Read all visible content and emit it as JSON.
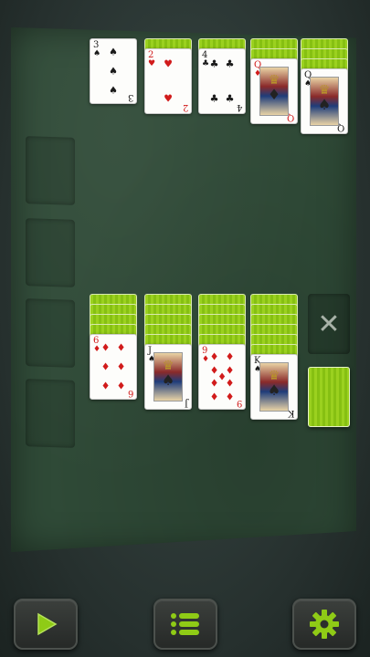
{
  "game": "Solitaire",
  "colors": {
    "felt": "#2f4a37",
    "card_back": "#8fcb16",
    "accent": "#8fcb16"
  },
  "foundation_columns": [
    {
      "backs": 0,
      "face": {
        "rank": "3",
        "suit": "♠",
        "color": "black",
        "kind": "pips",
        "count": 3
      }
    },
    {
      "backs": 1,
      "face": {
        "rank": "2",
        "suit": "♥",
        "color": "red",
        "kind": "pips",
        "count": 2
      }
    },
    {
      "backs": 1,
      "face": {
        "rank": "4",
        "suit": "♣",
        "color": "black",
        "kind": "pips",
        "count": 4
      }
    },
    {
      "backs": 2,
      "face": {
        "rank": "Q",
        "suit": "♦",
        "color": "red",
        "kind": "face"
      }
    },
    {
      "backs": 3,
      "face": {
        "rank": "Q",
        "suit": "♠",
        "color": "black",
        "kind": "face"
      }
    }
  ],
  "tableau_columns": [
    {
      "backs": 4,
      "face": {
        "rank": "6",
        "suit": "♦",
        "color": "red",
        "kind": "pips",
        "count": 6
      }
    },
    {
      "backs": 5,
      "face": {
        "rank": "J",
        "suit": "♠",
        "color": "black",
        "kind": "face"
      }
    },
    {
      "backs": 5,
      "face": {
        "rank": "9",
        "suit": "♦",
        "color": "red",
        "kind": "pips",
        "count": 9
      }
    },
    {
      "backs": 6,
      "face": {
        "rank": "K",
        "suit": "♠",
        "color": "black",
        "kind": "face"
      }
    }
  ],
  "waste": {
    "icon": "close-icon",
    "glyph": "✕"
  },
  "stock": {
    "icon": "card-back"
  },
  "toolbar": [
    {
      "name": "play-button",
      "icon": "play-icon"
    },
    {
      "name": "menu-button",
      "icon": "list-icon"
    },
    {
      "name": "settings-button",
      "icon": "gear-icon"
    }
  ]
}
